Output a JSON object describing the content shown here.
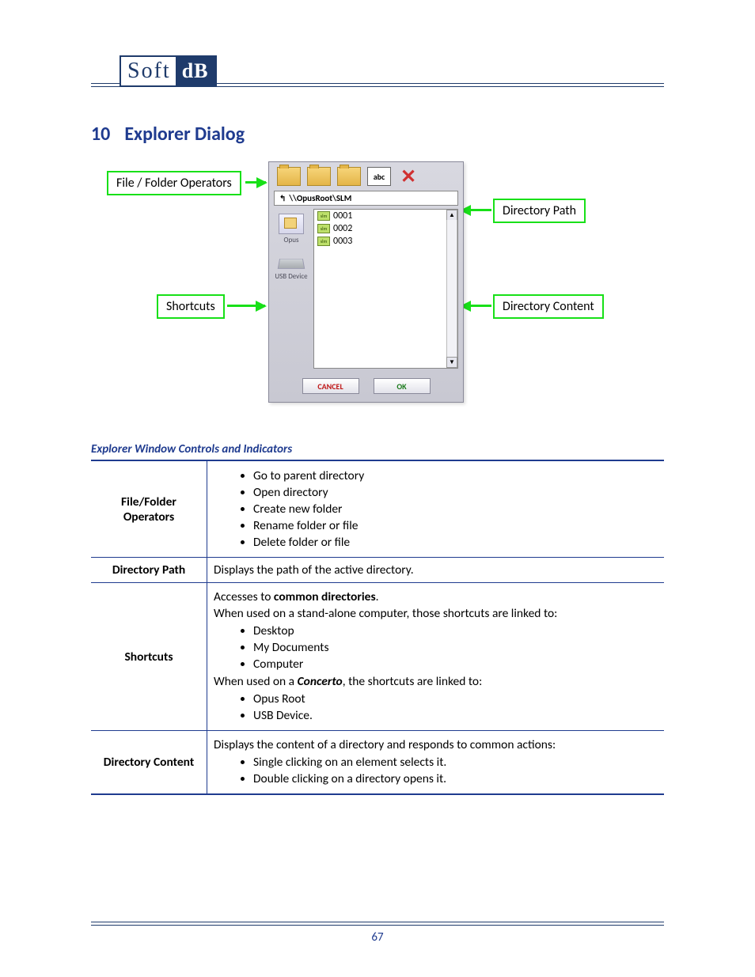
{
  "logo": {
    "left": "Soft",
    "right": "dB"
  },
  "heading": {
    "num": "10",
    "title": "Explorer Dialog"
  },
  "callouts": {
    "operators": "File / Folder Operators",
    "shortcuts": "Shortcuts",
    "path": "Directory Path",
    "content": "Directory Content"
  },
  "dialog": {
    "toolbar": {
      "rename": "abc"
    },
    "path": "\\\\OpusRoot\\SLM",
    "shortcuts": [
      {
        "label": "Opus",
        "type": "opus"
      },
      {
        "label": "USB Device",
        "type": "usb"
      }
    ],
    "items": [
      "0001",
      "0002",
      "0003"
    ],
    "cancel": "CANCEL",
    "ok": "OK"
  },
  "subhead": "Explorer Window Controls and Indicators",
  "table": {
    "r1": {
      "label": "File/Folder Operators",
      "items": [
        "Go to parent directory",
        "Open directory",
        "Create new folder",
        "Rename folder or file",
        "Delete folder or file"
      ]
    },
    "r2": {
      "label": "Directory Path",
      "text": "Displays the path of the active directory."
    },
    "r3": {
      "label": "Shortcuts",
      "intro_a": "Accesses to ",
      "intro_b": "common directories",
      "intro_c": ".",
      "line2": "When used on a stand-alone computer, those shortcuts are linked to:",
      "list1": [
        "Desktop",
        "My Documents",
        "Computer"
      ],
      "mid_a": "When used on a ",
      "mid_b": "Concerto",
      "mid_c": ", the shortcuts are linked to:",
      "list2": [
        "Opus Root",
        "USB Device."
      ]
    },
    "r4": {
      "label": "Directory Content",
      "text": "Displays the content of a directory and responds to common actions:",
      "items": [
        "Single clicking on an element selects it.",
        "Double clicking on a directory opens it."
      ]
    }
  },
  "pagenum": "67"
}
